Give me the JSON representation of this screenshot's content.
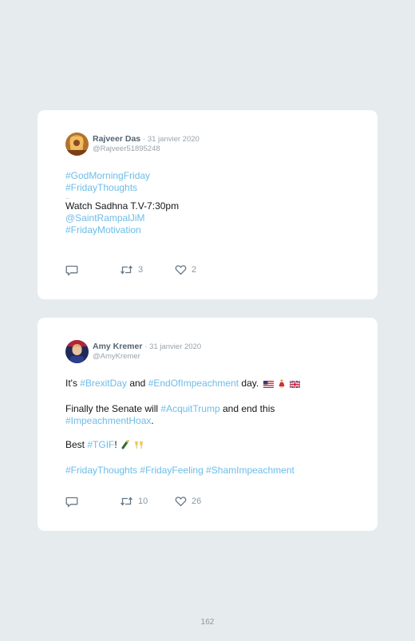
{
  "tweets": [
    {
      "name": "Rajveer Das",
      "date": "· 31 janvier 2020",
      "handle": "@Rajveer51895248",
      "lines": {
        "l1": "#GodMorningFriday",
        "l2": "#FridayThoughts",
        "l3": "..",
        "l4": "Watch Sadhna T.V-7:30pm",
        "l5": "@SaintRampalJiM",
        "l6": "#FridayMotivation"
      },
      "retweets": "3",
      "likes": "2"
    },
    {
      "name": "Amy Kremer",
      "date": "· 31 janvier 2020",
      "handle": "@AmyKremer",
      "p1": {
        "t1": "It's ",
        "h1": "#BrexitDay",
        "t2": " and ",
        "h2": "#EndOfImpeachment",
        "t3": " day."
      },
      "p2": {
        "t1": "Finally the Senate will ",
        "h1": "#AcquitTrump",
        "t2": " and end this",
        "h2": "#ImpeachmentHoax",
        "t3": "."
      },
      "p3": {
        "t1": "Best ",
        "h1": "#TGIF",
        "t2": "!"
      },
      "p4": {
        "h1": "#FridayThoughts",
        "h2": "#FridayFeeling",
        "h3": "#ShamImpeachment"
      },
      "retweets": "10",
      "likes": "26"
    }
  ],
  "page_number": "162",
  "icons": {
    "reply": "reply-icon",
    "retweet": "retweet-icon",
    "like": "heart-icon"
  },
  "colors": {
    "background": "#e6ebee",
    "card": "#ffffff",
    "hashtag": "#6cbde8",
    "muted": "#9aa4ad"
  }
}
